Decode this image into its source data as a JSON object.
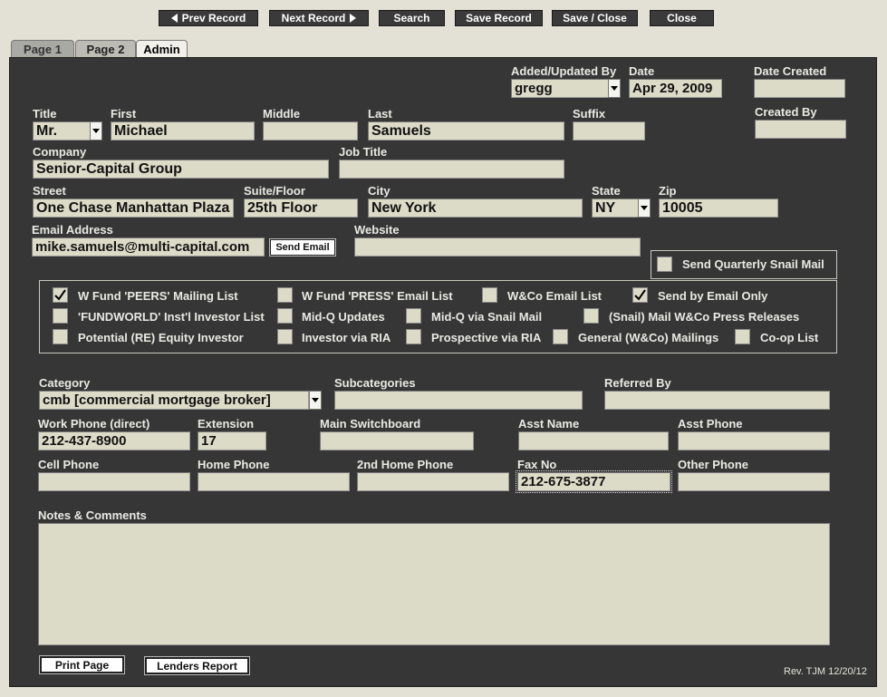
{
  "toolbar": {
    "prev": "Prev Record",
    "next": "Next Record",
    "search": "Search",
    "save": "Save Record",
    "save_close": "Save / Close",
    "close": "Close"
  },
  "tabs": [
    {
      "label": "Page 1"
    },
    {
      "label": "Page 2"
    },
    {
      "label": "Admin"
    }
  ],
  "admin": {
    "added_by_label": "Added/Updated By",
    "added_by_value": "gregg",
    "date_label": "Date",
    "date_value": "Apr 29, 2009",
    "date_created_label": "Date Created",
    "date_created_value": "",
    "created_by_label": "Created By",
    "created_by_value": ""
  },
  "name": {
    "title_label": "Title",
    "title_value": "Mr.",
    "first_label": "First",
    "first_value": "Michael",
    "middle_label": "Middle",
    "middle_value": "",
    "last_label": "Last",
    "last_value": "Samuels",
    "suffix_label": "Suffix",
    "suffix_value": ""
  },
  "company": {
    "company_label": "Company",
    "company_value": "Senior-Capital Group",
    "job_title_label": "Job Title",
    "job_title_value": ""
  },
  "address": {
    "street_label": "Street",
    "street_value": "One Chase Manhattan Plaza",
    "suite_label": "Suite/Floor",
    "suite_value": "25th Floor",
    "city_label": "City",
    "city_value": "New York",
    "state_label": "State",
    "state_value": "NY",
    "zip_label": "Zip",
    "zip_value": "10005"
  },
  "contact": {
    "email_label": "Email Address",
    "email_value": "mike.samuels@multi-capital.com",
    "send_email": "Send Email",
    "website_label": "Website",
    "website_value": ""
  },
  "snail_mail": {
    "label": "Send Quarterly Snail Mail",
    "checked": false
  },
  "lists": [
    {
      "label": "W Fund 'PEERS' Mailing List",
      "checked": true
    },
    {
      "label": "W Fund 'PRESS' Email List",
      "checked": false
    },
    {
      "label": "W&Co Email List",
      "checked": false
    },
    {
      "label": "Send by Email Only",
      "checked": true
    },
    {
      "label": "'FUNDWORLD' Inst'l Investor List",
      "checked": false
    },
    {
      "label": "Mid-Q Updates",
      "checked": false
    },
    {
      "label": "Mid-Q via Snail Mail",
      "checked": false
    },
    {
      "label": "(Snail) Mail W&Co Press Releases",
      "checked": false
    },
    {
      "label": "Potential (RE) Equity Investor",
      "checked": false
    },
    {
      "label": "Investor via RIA",
      "checked": false
    },
    {
      "label": "Prospective via RIA",
      "checked": false
    },
    {
      "label": "General (W&Co) Mailings",
      "checked": false
    },
    {
      "label": "Co-op List",
      "checked": false
    }
  ],
  "category": {
    "category_label": "Category",
    "category_value": "cmb [commercial mortgage broker]",
    "subcategories_label": "Subcategories",
    "subcategories_value": "",
    "referred_label": "Referred By",
    "referred_value": ""
  },
  "phones": {
    "work_label": "Work Phone (direct)",
    "work_value": "212-437-8900",
    "ext_label": "Extension",
    "ext_value": "17",
    "switch_label": "Main Switchboard",
    "switch_value": "",
    "asst_name_label": "Asst Name",
    "asst_name_value": "",
    "asst_phone_label": "Asst Phone",
    "asst_phone_value": "",
    "cell_label": "Cell Phone",
    "cell_value": "",
    "home_label": "Home Phone",
    "home_value": "",
    "home2_label": "2nd Home Phone",
    "home2_value": "",
    "fax_label": "Fax No",
    "fax_value": "212-675-3877",
    "other_label": "Other Phone",
    "other_value": ""
  },
  "notes": {
    "label": "Notes & Comments",
    "value": ""
  },
  "footer": {
    "print": "Print Page",
    "lenders": "Lenders Report",
    "rev": "Rev. TJM 12/20/12"
  }
}
